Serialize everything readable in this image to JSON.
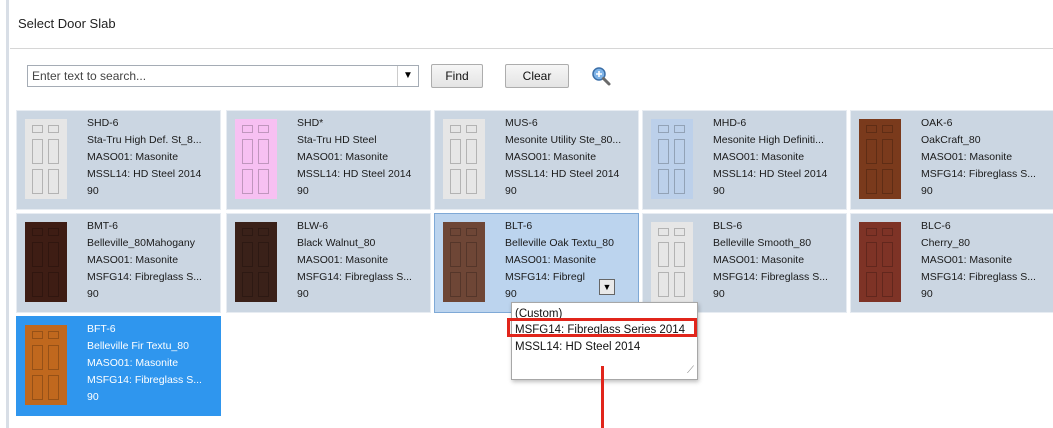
{
  "dialog": {
    "title": "Select Door Slab"
  },
  "search": {
    "placeholder": "Enter text to search...",
    "find_label": "Find",
    "clear_label": "Clear"
  },
  "cards": [
    {
      "code": "SHD-6",
      "name": "Sta-Tru High Def. St_8...",
      "mfr": "MASO01: Masonite",
      "series": "MSSL14: HD Steel 2014",
      "num": "90",
      "color": "#e6e6e6"
    },
    {
      "code": "SHD*",
      "name": "Sta-Tru HD Steel",
      "mfr": "MASO01: Masonite",
      "series": "MSSL14: HD Steel 2014",
      "num": "90",
      "color": "#f7c0f2"
    },
    {
      "code": "MUS-6",
      "name": "Mesonite Utility Ste_80...",
      "mfr": "MASO01: Masonite",
      "series": "MSSL14: HD Steel 2014",
      "num": "90",
      "color": "#e6e6e6"
    },
    {
      "code": "MHD-6",
      "name": "Mesonite High Definiti...",
      "mfr": "MASO01: Masonite",
      "series": "MSSL14: HD Steel 2014",
      "num": "90",
      "color": "#bcd0ea"
    },
    {
      "code": "OAK-6",
      "name": "OakCraft_80",
      "mfr": "MASO01: Masonite",
      "series": "MSFG14: Fibreglass S...",
      "num": "90",
      "color": "#7a3a1c"
    },
    {
      "code": "BMT-6",
      "name": "Belleville_80Mahogany",
      "mfr": "MASO01: Masonite",
      "series": "MSFG14: Fibreglass S...",
      "num": "90",
      "color": "#3e1d14"
    },
    {
      "code": "BLW-6",
      "name": "Black Walnut_80",
      "mfr": "MASO01: Masonite",
      "series": "MSFG14: Fibreglass S...",
      "num": "90",
      "color": "#3a2119"
    },
    {
      "code": "BLT-6",
      "name": "Belleville Oak Textu_80",
      "mfr": "MASO01: Masonite",
      "series": "MSFG14: Fibregl",
      "num": "90",
      "color": "#6e4636"
    },
    {
      "code": "BLS-6",
      "name": "Belleville Smooth_80",
      "mfr": "MASO01: Masonite",
      "series": "MSFG14: Fibreglass S...",
      "num": "90",
      "color": "#e6e6e6"
    },
    {
      "code": "BLC-6",
      "name": "Cherry_80",
      "mfr": "MASO01: Masonite",
      "series": "MSFG14: Fibreglass S...",
      "num": "90",
      "color": "#7e3326"
    },
    {
      "code": "BFT-6",
      "name": "Belleville Fir Textu_80",
      "mfr": "MASO01: Masonite",
      "series": "MSFG14: Fibreglass S...",
      "num": "90",
      "color": "#c0681e"
    }
  ],
  "dropdown": {
    "options": [
      "(Custom)",
      "MSFG14: Fibreglass Series 2014",
      "MSSL14: HD Steel 2014"
    ],
    "selected": "MSFG14: Fibreglass Series 2014"
  },
  "colors": {
    "accent_red": "#e1251b",
    "highlight_blue": "#2f96ee",
    "card_bg": "#cbd6e2"
  }
}
